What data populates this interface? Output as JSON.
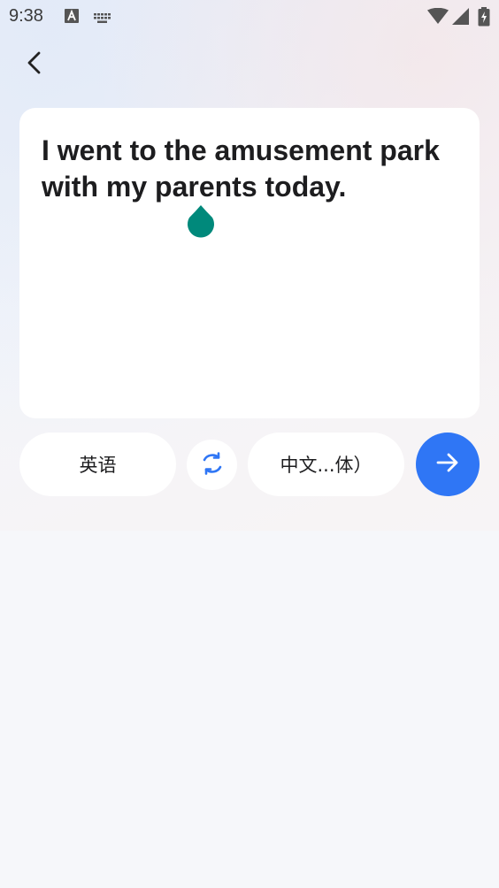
{
  "status_bar": {
    "time": "9:38",
    "icons": [
      "text-a-icon",
      "keyboard-icon",
      "wifi-icon",
      "signal-icon",
      "battery-charging-icon"
    ]
  },
  "nav": {
    "back_icon": "chevron-left-icon"
  },
  "input": {
    "text": "I went to the amusement park with my parents today."
  },
  "languages": {
    "source": "英语",
    "target": "中文...体）",
    "swap_icon": "swap-icon",
    "translate_icon": "arrow-right-icon"
  },
  "colors": {
    "accent": "#2f76f5",
    "handle": "#00897b",
    "text": "#1d1d1f"
  }
}
